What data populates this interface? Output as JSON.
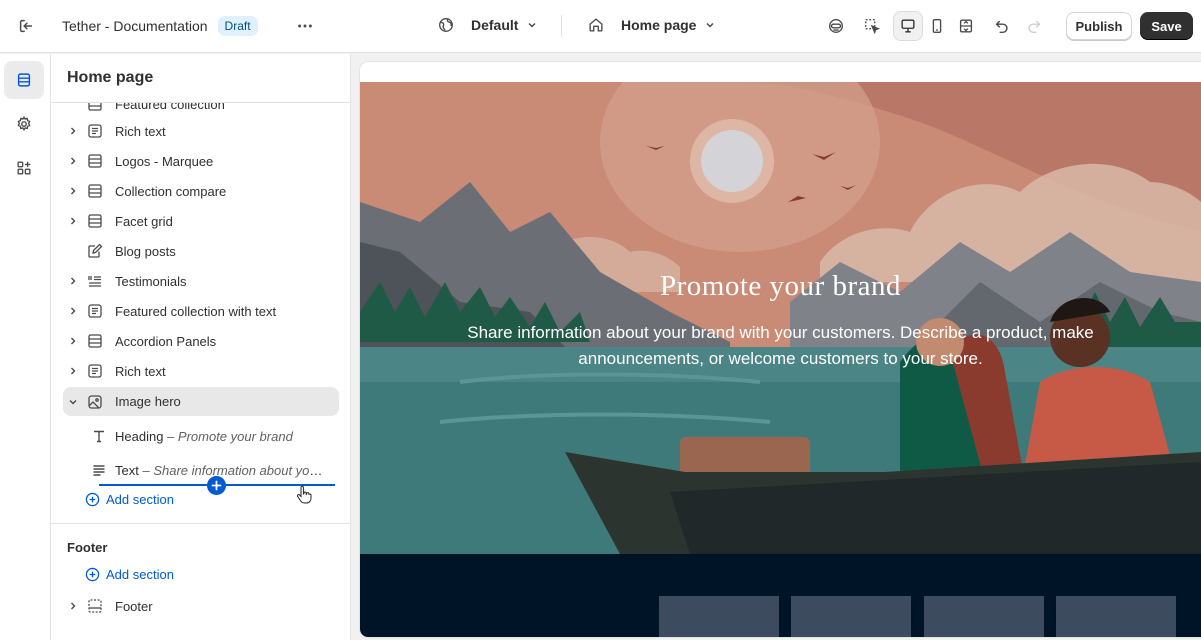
{
  "topbar": {
    "store_title": "Tether - Documentation",
    "status_badge": "Draft",
    "theme_selector": "Default",
    "page_selector": "Home page",
    "publish_label": "Publish",
    "save_label": "Save"
  },
  "sidebar": {
    "title": "Home page",
    "partial_item": "Featured collection",
    "sections": [
      {
        "label": "Rich text",
        "icon": "text-block-icon",
        "expandable": true
      },
      {
        "label": "Logos - Marquee",
        "icon": "layout-rows-icon",
        "expandable": true
      },
      {
        "label": "Collection compare",
        "icon": "layout-rows-icon",
        "expandable": true
      },
      {
        "label": "Facet grid",
        "icon": "layout-rows-icon",
        "expandable": true
      },
      {
        "label": "Blog posts",
        "icon": "blog-edit-icon",
        "expandable": false
      },
      {
        "label": "Testimonials",
        "icon": "list-quote-icon",
        "expandable": true
      },
      {
        "label": "Featured collection with text",
        "icon": "text-block-icon",
        "expandable": true
      },
      {
        "label": "Accordion Panels",
        "icon": "layout-rows-icon",
        "expandable": true
      },
      {
        "label": "Rich text",
        "icon": "text-block-icon",
        "expandable": true
      },
      {
        "label": "Image hero",
        "icon": "image-icon",
        "expandable": true,
        "expanded": true
      }
    ],
    "blocks": [
      {
        "name": "Heading",
        "separator": " – ",
        "value": "Promote your brand"
      },
      {
        "name": "Text",
        "separator": " – ",
        "value": "Share information about your brand with your customers."
      }
    ],
    "add_section_label": "Add section",
    "footer_group_title": "Footer",
    "footer_add_section_label": "Add section",
    "footer_item": "Footer"
  },
  "preview": {
    "hero_heading": "Promote your brand",
    "hero_text": "Share information about your brand with your customers. Describe a product, make announcements, or welcome customers to your store."
  }
}
